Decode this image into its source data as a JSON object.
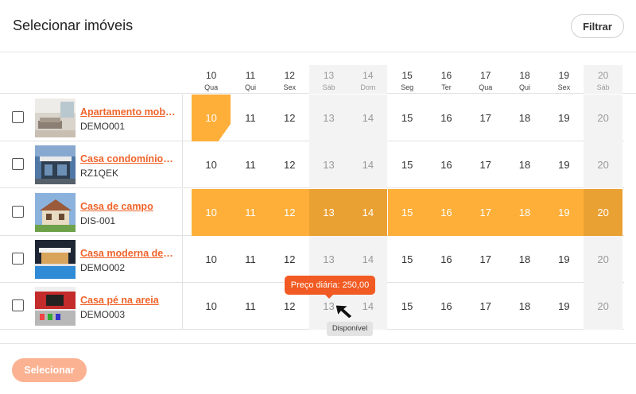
{
  "header": {
    "title": "Selecionar imóveis",
    "filter_label": "Filtrar"
  },
  "dates": [
    {
      "day": "10",
      "dow": "Qua",
      "weekend": false
    },
    {
      "day": "11",
      "dow": "Qui",
      "weekend": false
    },
    {
      "day": "12",
      "dow": "Sex",
      "weekend": false
    },
    {
      "day": "13",
      "dow": "Sáb",
      "weekend": true
    },
    {
      "day": "14",
      "dow": "Dom",
      "weekend": true
    },
    {
      "day": "15",
      "dow": "Seg",
      "weekend": false
    },
    {
      "day": "16",
      "dow": "Ter",
      "weekend": false
    },
    {
      "day": "17",
      "dow": "Qua",
      "weekend": false
    },
    {
      "day": "18",
      "dow": "Qui",
      "weekend": false
    },
    {
      "day": "19",
      "dow": "Sex",
      "weekend": false
    },
    {
      "day": "20",
      "dow": "Sáb",
      "weekend": true
    }
  ],
  "properties": [
    {
      "name": "Apartamento mobiliado",
      "code": "DEMO001",
      "checked": false,
      "thumb": "living-room",
      "selected_days": [
        "10"
      ],
      "partial_day": "10"
    },
    {
      "name": "Casa condomínio fechado",
      "code": "RZ1QEK",
      "checked": false,
      "thumb": "modern-house-blue",
      "selected_days": []
    },
    {
      "name": "Casa de campo",
      "code": "DIS-001",
      "checked": false,
      "thumb": "country-house",
      "selected_days": [
        "10",
        "11",
        "12",
        "13",
        "14",
        "15",
        "16",
        "17",
        "18",
        "19",
        "20"
      ]
    },
    {
      "name": "Casa moderna de praia",
      "code": "DEMO002",
      "checked": false,
      "thumb": "pool-house",
      "selected_days": []
    },
    {
      "name": "Casa pé na areia",
      "code": "DEMO003",
      "checked": false,
      "thumb": "red-room",
      "selected_days": []
    }
  ],
  "tooltip": {
    "price": "Preço diária: 250,00",
    "availability": "Disponível"
  },
  "footer": {
    "select_label": "Selecionar"
  },
  "colors": {
    "accent": "#f0642b",
    "selected": "#fdaf3a",
    "tooltip": "#f15a22"
  }
}
